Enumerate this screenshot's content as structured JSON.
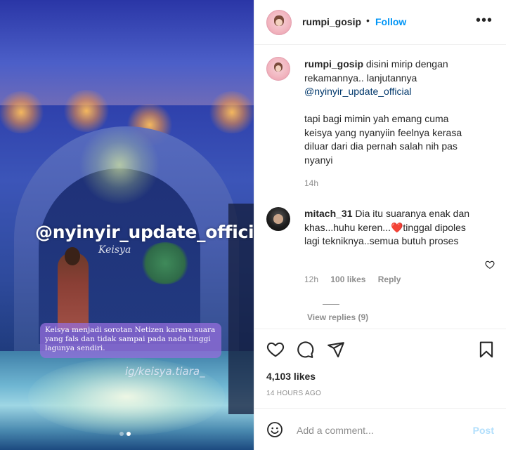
{
  "media": {
    "watermark": "@nyinyir_update_official",
    "signature": "Keisya",
    "caption_line1": "Keisya menjadi sorotan Netizen karena suara",
    "caption_line2": "yang fals dan tidak sampai pada nada tinggi",
    "caption_line3": "lagunya sendiri.",
    "handle": "ig/keisya.tiara_",
    "carousel": {
      "count": 2,
      "active": 2
    }
  },
  "header": {
    "username": "rumpi_gosip",
    "separator": "•",
    "follow_label": "Follow",
    "more_label": "•••"
  },
  "caption": {
    "username": "rumpi_gosip",
    "text_part1": " disini mirip dengan rekamannya.. lanjutannya",
    "mention": "@nyinyir_update_official",
    "text_part2": "tapi bagi mimin yah emang cuma keisya yang nyanyiin feelnya kerasa diluar dari dia pernah salah nih pas nyanyi",
    "time": "14h"
  },
  "comment": {
    "username": "mitach_31",
    "text": " Dia itu suaranya enak dan khas...huhu keren...",
    "heart_emoji": "❤️",
    "text_after": "tinggal dipoles lagi tekniknya..semua butuh proses",
    "time": "12h",
    "likes": "100 likes",
    "reply_label": "Reply",
    "view_replies": "View replies (9)"
  },
  "actions": {
    "likes_count": "4,103 likes",
    "timestamp": "14 HOURS AGO"
  },
  "composer": {
    "placeholder": "Add a comment...",
    "post_label": "Post"
  },
  "icons": {
    "like": "heart-icon",
    "comment": "comment-icon",
    "share": "share-icon",
    "save": "bookmark-icon",
    "emoji": "emoji-icon",
    "more": "more-icon",
    "comment_like": "heart-icon"
  },
  "colors": {
    "accent": "#0095f6",
    "link": "#00376b",
    "muted": "#8e8e8e",
    "post_disabled": "#b2dffc",
    "heart": "#ed4956"
  }
}
